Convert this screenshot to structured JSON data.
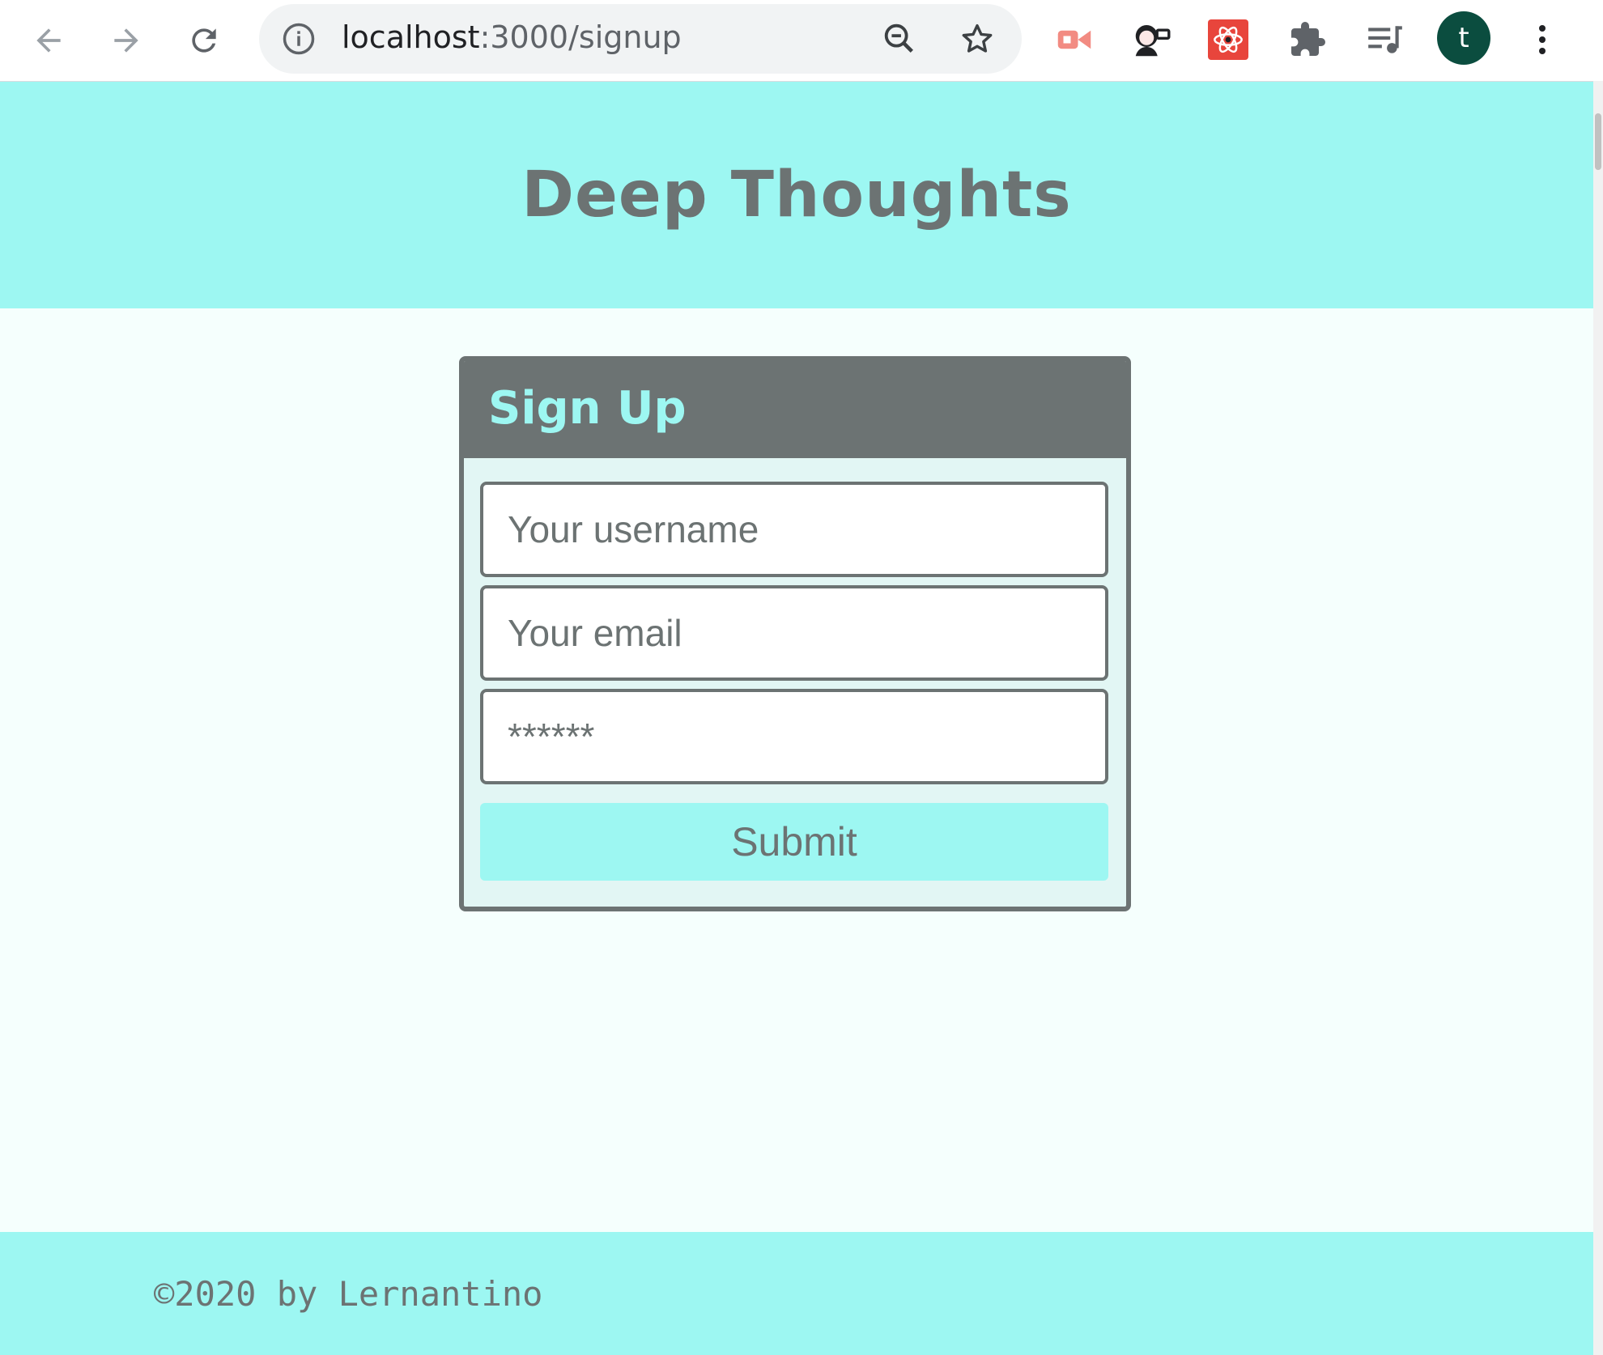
{
  "browser": {
    "url_host": "localhost",
    "url_path": ":3000/signup",
    "profile_initial": "t",
    "icons": [
      "back-arrow-icon",
      "forward-arrow-icon",
      "reload-icon",
      "info-icon",
      "zoom-out-icon",
      "star-icon",
      "extension-icon",
      "puzzle-icon",
      "media-control-icon",
      "more-vert-icon"
    ]
  },
  "header": {
    "title": "Deep Thoughts"
  },
  "signup": {
    "title": "Sign Up",
    "username_placeholder": "Your username",
    "email_placeholder": "Your email",
    "password_placeholder": "******",
    "submit_label": "Submit"
  },
  "footer": {
    "text": "©2020 by Lernantino"
  },
  "colors": {
    "accent": "#9df7f2",
    "dark": "#6c7373",
    "background": "#f5fffd",
    "card_body": "#e2f6f4"
  }
}
